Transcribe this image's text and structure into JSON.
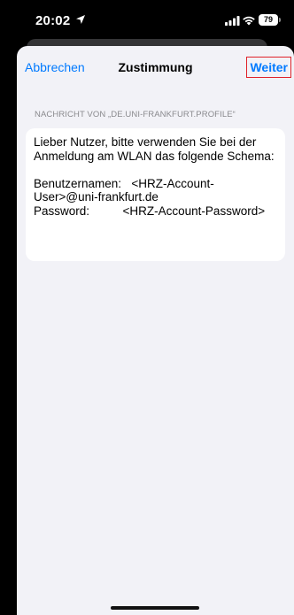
{
  "status_bar": {
    "time": "20:02",
    "battery": "79",
    "icons": [
      "location-arrow-icon",
      "signal-icon",
      "wifi-icon",
      "battery-icon"
    ]
  },
  "nav": {
    "cancel_label": "Abbrechen",
    "title": "Zustimmung",
    "next_label": "Weiter"
  },
  "section": {
    "header": "NACHRICHT VON „DE.UNI-FRANKFURT.PROFILE“"
  },
  "message": {
    "text": "Lieber Nutzer, bitte verwenden Sie bei der Anmeldung am WLAN das folgende Schema:\n\nBenutzernamen:   <HRZ-Account-User>@uni-frankfurt.de\nPassword:          <HRZ-Account-Password>"
  },
  "colors": {
    "accent": "#007aff",
    "highlight_border": "#e0222a",
    "sheet_background": "#f2f2f7"
  }
}
